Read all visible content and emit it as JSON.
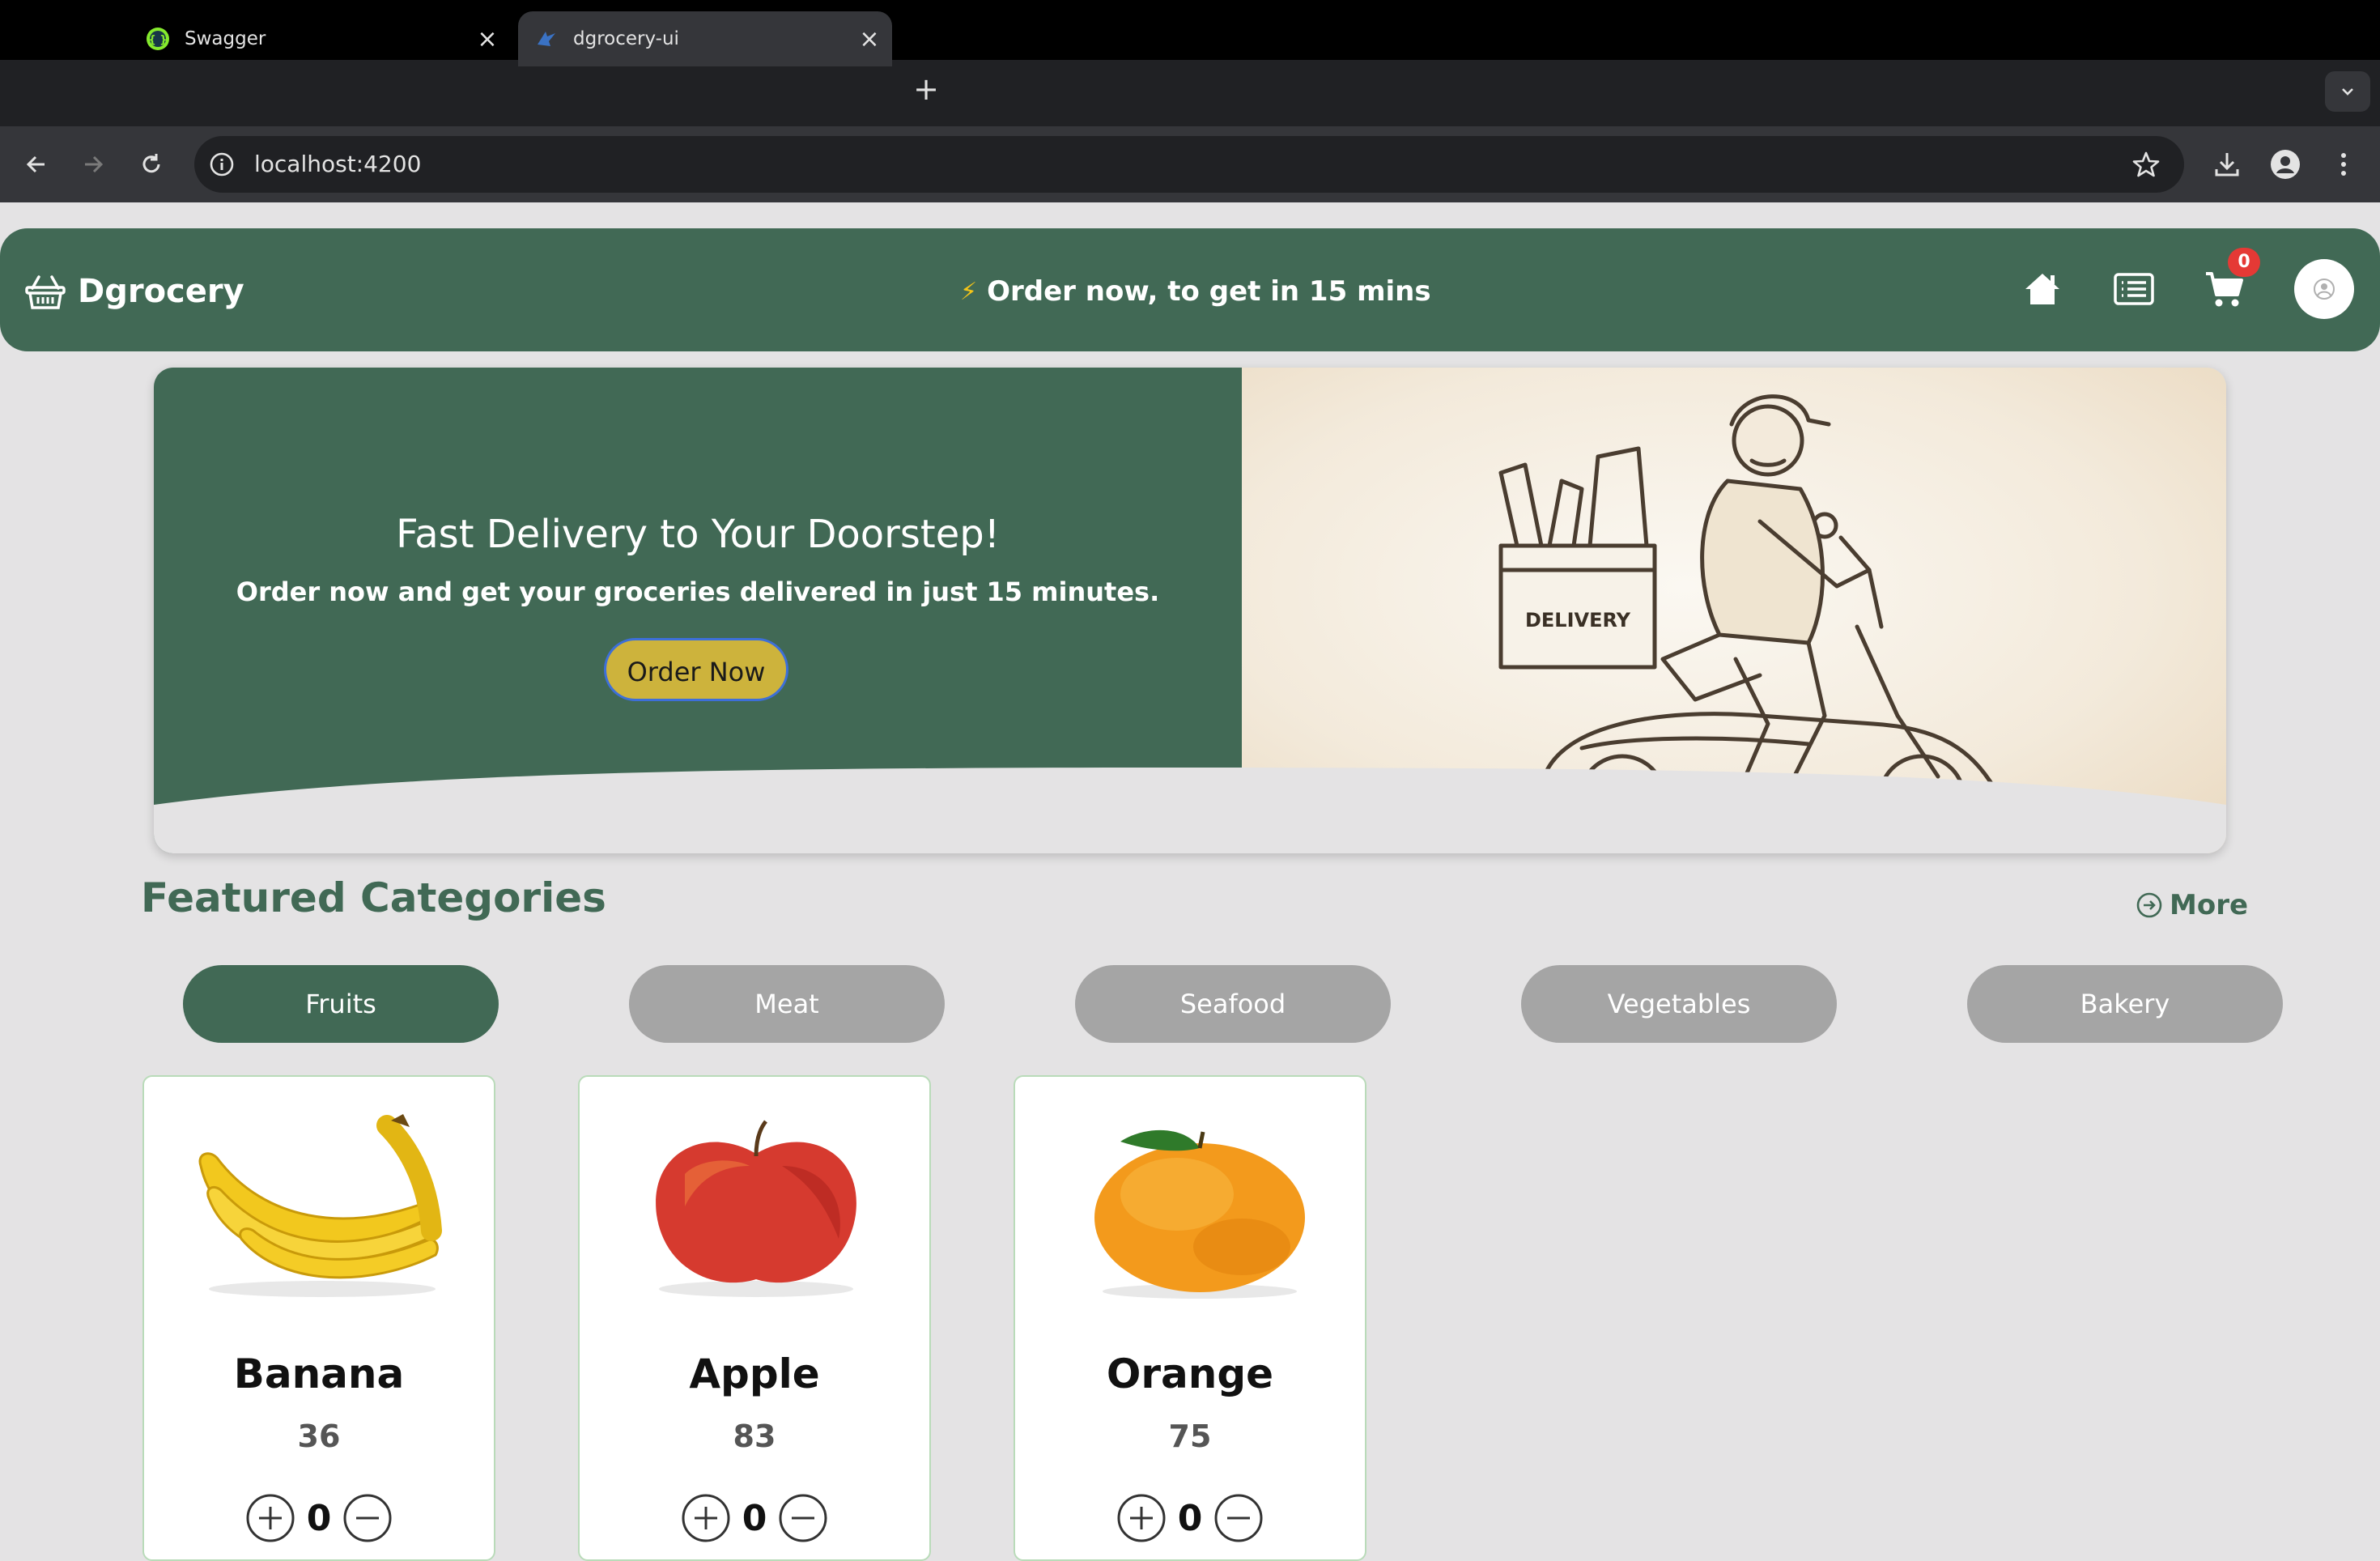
{
  "browser": {
    "tabs": [
      {
        "title": "Swagger",
        "active": false
      },
      {
        "title": "dgrocery-ui",
        "active": true
      }
    ],
    "url": "localhost:4200"
  },
  "header": {
    "brand": "Dgrocery",
    "promo": "Order now, to get in 15 mins",
    "cart_count": "0"
  },
  "hero": {
    "title": "Fast Delivery to Your Doorstep!",
    "subtitle": "Order now and get your groceries delivered in just 15 minutes.",
    "button": "Order Now",
    "image_label": "DELIVERY"
  },
  "featured": {
    "title": "Featured Categories",
    "more": "More",
    "categories": [
      {
        "label": "Fruits",
        "active": true
      },
      {
        "label": "Meat",
        "active": false
      },
      {
        "label": "Seafood",
        "active": false
      },
      {
        "label": "Vegetables",
        "active": false
      },
      {
        "label": "Bakery",
        "active": false
      }
    ]
  },
  "products": [
    {
      "name": "Banana",
      "price": "36",
      "qty": "0",
      "image": "banana"
    },
    {
      "name": "Apple",
      "price": "83",
      "qty": "0",
      "image": "apple"
    },
    {
      "name": "Orange",
      "price": "75",
      "qty": "0",
      "image": "orange"
    }
  ],
  "colors": {
    "brand_green": "#416955",
    "accent_yellow": "#cdb33c",
    "pill_inactive": "#a5a5a5",
    "badge_red": "#e53935",
    "page_bg": "#e4e3e4"
  }
}
